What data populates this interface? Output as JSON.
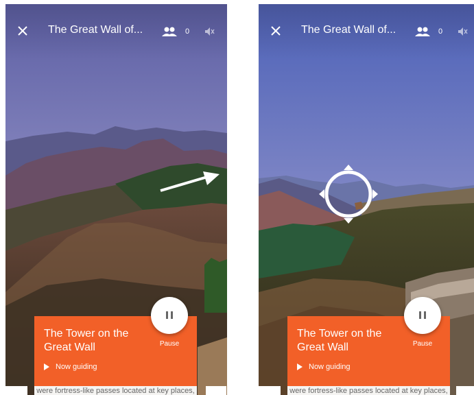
{
  "screens": [
    {
      "header": {
        "title": "The Great Wall of...",
        "viewer_count": "0",
        "icons": [
          "close-icon",
          "people-icon",
          "mute-icon"
        ]
      },
      "overlay": {
        "kind": "swipe-arrow",
        "icon": "arrow-right-icon"
      },
      "card": {
        "title": "The Tower on the Great Wall",
        "status": "Now guiding",
        "pause_label": "Pause"
      },
      "sheet": {
        "text": "were fortress-like passes located at key places, such as"
      }
    },
    {
      "header": {
        "title": "The Great Wall of...",
        "viewer_count": "0",
        "icons": [
          "close-icon",
          "people-icon",
          "mute-icon"
        ]
      },
      "overlay": {
        "kind": "compass-target",
        "icon": "compass-icon"
      },
      "card": {
        "title": "The Tower on the Great Wall",
        "status": "Now guiding",
        "pause_label": "Pause"
      },
      "sheet": {
        "text": "were fortress-like passes located at key places, such as"
      }
    }
  ],
  "colors": {
    "card": "#f26028",
    "header_text": "#ffffff"
  }
}
